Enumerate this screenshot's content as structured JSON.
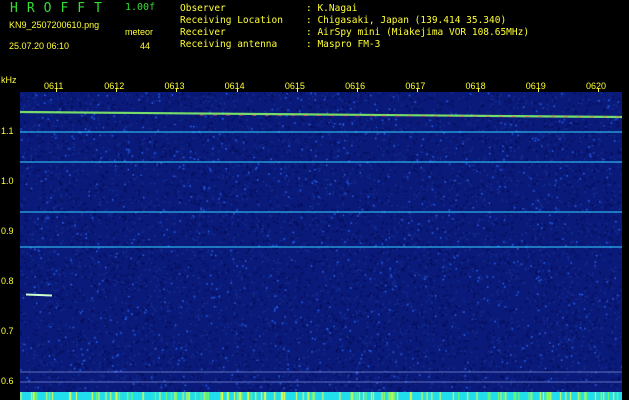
{
  "header": {
    "app_title": "HROFFT",
    "version": "1.00f",
    "file_name": "KN9_2507200610.png",
    "meteor_label": "meteor",
    "datetime": "25.07.20 06:10",
    "meteor_count": "44",
    "info": [
      {
        "label": "Observer",
        "value": ": K.Nagai"
      },
      {
        "label": "Receiving Location",
        "value": ": Chigasaki, Japan (139.414 35.340)"
      },
      {
        "label": "Receiver",
        "value": ": AirSpy mini (Miakejima VOR 108.65MHz)"
      },
      {
        "label": "Receiving antenna",
        "value": ": Maspro FM-3"
      }
    ]
  },
  "chart_data": {
    "type": "heatmap",
    "ylabel": "kHz",
    "x_ticks": [
      "0611",
      "0612",
      "0613",
      "0614",
      "0615",
      "0616",
      "0617",
      "0618",
      "0619",
      "0620"
    ],
    "y_ticks": [
      "1.1",
      "1.0",
      "0.9",
      "0.8",
      "0.7",
      "0.6"
    ],
    "ylim": [
      0.58,
      1.18
    ],
    "horizontal_lines_khz": [
      1.14,
      1.1,
      1.04,
      0.94,
      0.87,
      0.62,
      0.6
    ],
    "meteor_trace": {
      "time": "0611",
      "khz": 0.775
    }
  },
  "colors": {
    "background": "#000000",
    "label_text": "#ffff33",
    "title_text": "#33dd33",
    "noise_dark": "#0a1a7a",
    "noise_bright": "#2a6cff",
    "line_cyan": "#33ccff",
    "line_green": "#88ff66",
    "line_red": "#ff5555",
    "bottom_bar": "#22ddee",
    "bottom_spikes": "#ffff33"
  }
}
